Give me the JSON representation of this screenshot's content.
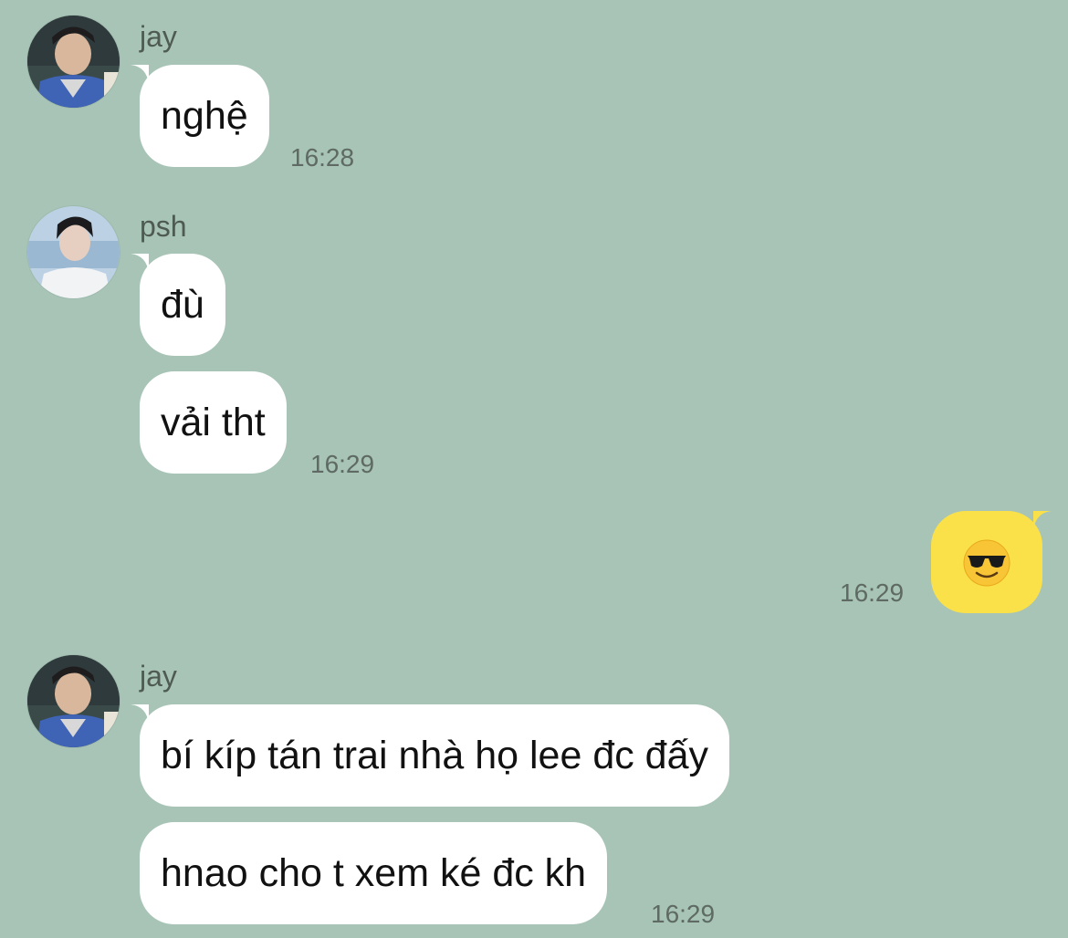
{
  "colors": {
    "background": "#a7c4b6",
    "incoming_bubble": "#ffffff",
    "outgoing_bubble": "#fae14a",
    "timestamp": "#5e6a63",
    "sender_name": "#4e5a52"
  },
  "messages": [
    {
      "sender": "jay",
      "avatar_icon": "avatar-jay",
      "bubbles": [
        "nghệ"
      ],
      "time": "16:28"
    },
    {
      "sender": "psh",
      "avatar_icon": "avatar-psh",
      "bubbles": [
        "đù",
        "vải tht"
      ],
      "time": "16:29"
    },
    {
      "sender": "me",
      "outgoing": true,
      "emoji_icon": "sunglasses-emoji-icon",
      "time": "16:29"
    },
    {
      "sender": "jay",
      "avatar_icon": "avatar-jay",
      "bubbles": [
        "bí kíp tán trai nhà họ lee đc đấy",
        "hnao cho t xem ké đc kh"
      ],
      "time": "16:29"
    }
  ]
}
